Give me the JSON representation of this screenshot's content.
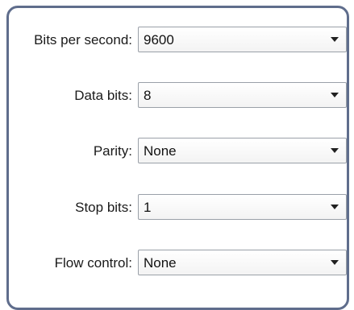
{
  "fields": [
    {
      "label": "Bits per second:",
      "value": "9600"
    },
    {
      "label": "Data bits:",
      "value": "8"
    },
    {
      "label": "Parity:",
      "value": "None"
    },
    {
      "label": "Stop bits:",
      "value": "1"
    },
    {
      "label": "Flow control:",
      "value": "None"
    }
  ],
  "icons": {
    "dropdown": "chevron-down-icon"
  },
  "colors": {
    "panel_border": "#5f6d8c",
    "select_border": "#9aa0a8"
  }
}
